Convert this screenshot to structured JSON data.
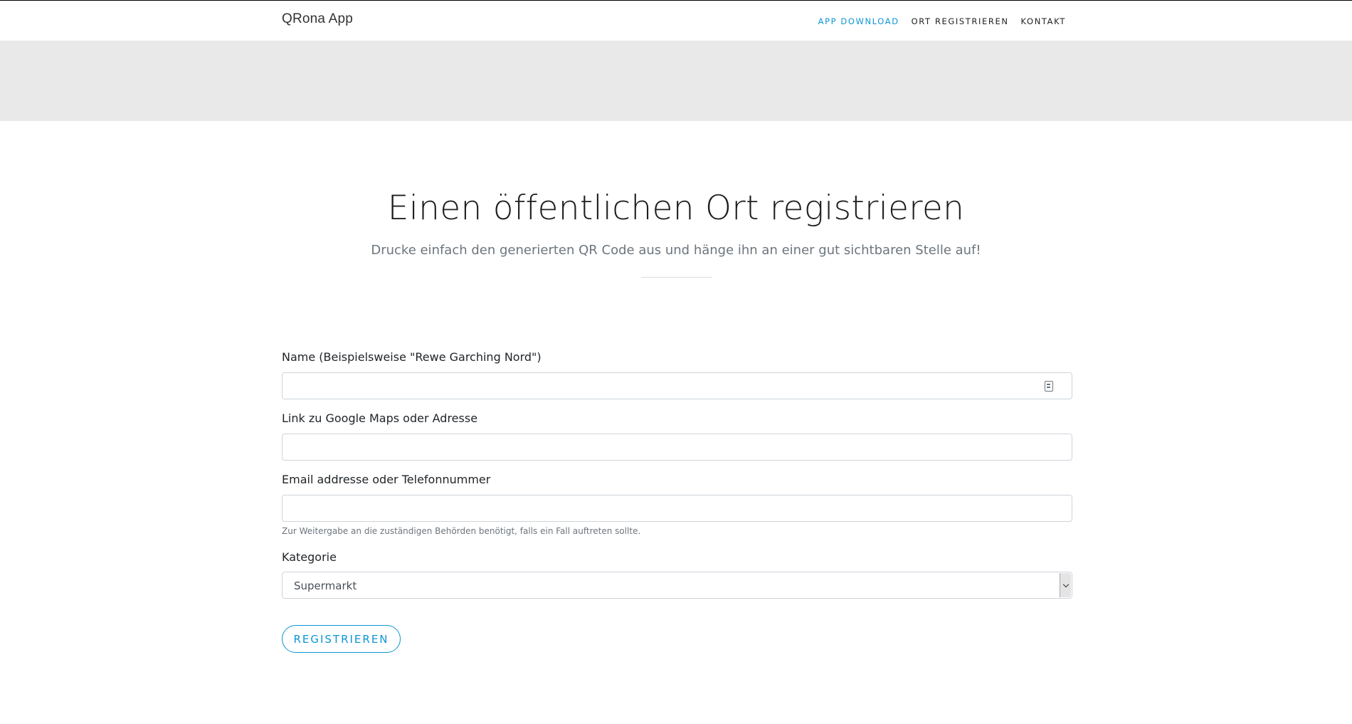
{
  "navbar": {
    "brand": "QRona App",
    "links": [
      {
        "label": "APP DOWNLOAD",
        "active": true
      },
      {
        "label": "ORT REGISTRIEREN",
        "active": false
      },
      {
        "label": "KONTAKT",
        "active": false
      }
    ]
  },
  "main": {
    "title": "Einen öffentlichen Ort registrieren",
    "subtitle": "Drucke einfach den generierten QR Code aus und hänge ihn an einer gut sichtbaren Stelle auf!"
  },
  "form": {
    "name_label": "Name (Beispielsweise \"Rewe Garching Nord\")",
    "name_value": "",
    "address_label": "Link zu Google Maps oder Adresse",
    "address_value": "",
    "contact_label": "Email addresse oder Telefonnummer",
    "contact_value": "",
    "contact_hint": "Zur Weitergabe an die zuständigen Behörden benötigt, falls ein Fall auftreten sollte.",
    "category_label": "Kategorie",
    "category_value": "Supermarkt",
    "submit_label": "REGISTRIEREN"
  },
  "colors": {
    "accent": "#0d95d4",
    "hero_band": "#e9e9e9"
  },
  "icons": {
    "name_field_icon": "contact-card-icon",
    "select_arrow": "chevron-down-icon"
  }
}
